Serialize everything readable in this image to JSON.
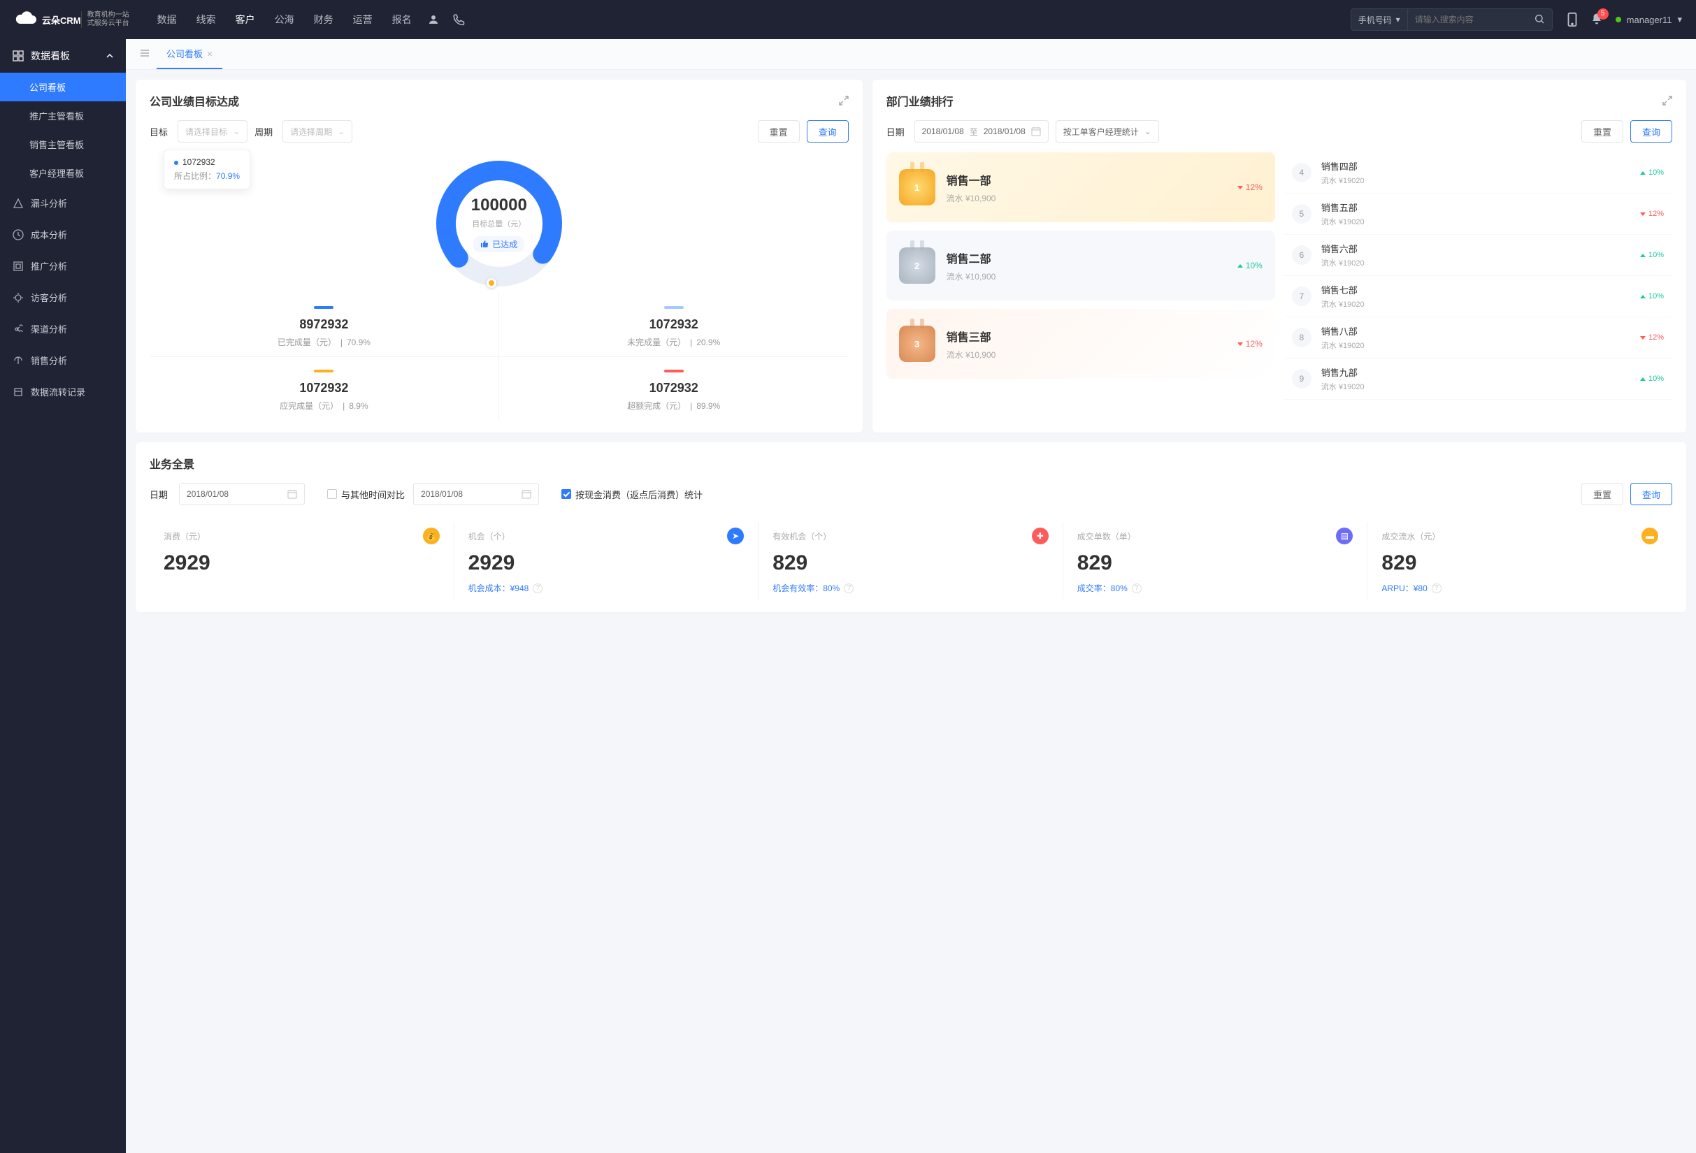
{
  "brand": {
    "main": "云朵CRM",
    "sub1": "教育机构一站",
    "sub2": "式服务云平台"
  },
  "nav": [
    "数据",
    "线索",
    "客户",
    "公海",
    "财务",
    "运营",
    "报名"
  ],
  "nav_active_idx": 2,
  "search": {
    "type_label": "手机号码",
    "placeholder": "请输入搜索内容"
  },
  "notif_count": "5",
  "username": "manager11",
  "sidebar": {
    "head": "数据看板",
    "subs": [
      "公司看板",
      "推广主管看板",
      "销售主管看板",
      "客户经理看板"
    ],
    "sub_active_idx": 0,
    "items": [
      "漏斗分析",
      "成本分析",
      "推广分析",
      "访客分析",
      "渠道分析",
      "销售分析",
      "数据流转记录"
    ]
  },
  "tab_label": "公司看板",
  "goals": {
    "title": "公司业绩目标达成",
    "target_label": "目标",
    "target_placeholder": "请选择目标",
    "period_label": "周期",
    "period_placeholder": "请选择周期",
    "reset": "重置",
    "query": "查询",
    "tooltip_value": "1072932",
    "tooltip_ratio_label": "所占比例：",
    "tooltip_ratio": "70.9%",
    "center_value": "100000",
    "center_label": "目标总量（元）",
    "achieved": "已达成",
    "stats": [
      {
        "bar": "blue",
        "value": "8972932",
        "label": "已完成量（元）",
        "pct": "70.9%"
      },
      {
        "bar": "lblue",
        "value": "1072932",
        "label": "未完成量（元）",
        "pct": "20.9%"
      },
      {
        "bar": "orange",
        "value": "1072932",
        "label": "应完成量（元）",
        "pct": "8.9%"
      },
      {
        "bar": "red",
        "value": "1072932",
        "label": "超额完成（元）",
        "pct": "89.9%"
      }
    ]
  },
  "ranking": {
    "title": "部门业绩排行",
    "date_label": "日期",
    "date_from": "2018/01/08",
    "date_to_label": "至",
    "date_to": "2018/01/08",
    "group_label": "按工单客户经理统计",
    "reset": "重置",
    "query": "查询",
    "podium": [
      {
        "rank": "1",
        "name": "销售一部",
        "sub": "流水 ¥10,900",
        "pct": "12%",
        "dir": "down",
        "cls": "gold",
        "m": "g"
      },
      {
        "rank": "2",
        "name": "销售二部",
        "sub": "流水 ¥10,900",
        "pct": "10%",
        "dir": "up",
        "cls": "silver",
        "m": "s"
      },
      {
        "rank": "3",
        "name": "销售三部",
        "sub": "流水 ¥10,900",
        "pct": "12%",
        "dir": "down",
        "cls": "bronze",
        "m": "b"
      }
    ],
    "rows": [
      {
        "num": "4",
        "name": "销售四部",
        "sub": "流水 ¥19020",
        "pct": "10%",
        "dir": "up"
      },
      {
        "num": "5",
        "name": "销售五部",
        "sub": "流水 ¥19020",
        "pct": "12%",
        "dir": "down"
      },
      {
        "num": "6",
        "name": "销售六部",
        "sub": "流水 ¥19020",
        "pct": "10%",
        "dir": "up"
      },
      {
        "num": "7",
        "name": "销售七部",
        "sub": "流水 ¥19020",
        "pct": "10%",
        "dir": "up"
      },
      {
        "num": "8",
        "name": "销售八部",
        "sub": "流水 ¥19020",
        "pct": "12%",
        "dir": "down"
      },
      {
        "num": "9",
        "name": "销售九部",
        "sub": "流水 ¥19020",
        "pct": "10%",
        "dir": "up"
      }
    ]
  },
  "overview": {
    "title": "业务全景",
    "date_label": "日期",
    "date1": "2018/01/08",
    "compare_label": "与其他时间对比",
    "date2": "2018/01/08",
    "cash_label": "按现金消费（返点后消费）统计",
    "reset": "重置",
    "query": "查询",
    "metrics": [
      {
        "label": "消费（元）",
        "value": "2929",
        "icon": "o",
        "sub": ""
      },
      {
        "label": "机会（个）",
        "value": "2929",
        "icon": "b",
        "sub_label": "机会成本：",
        "sub_val": "¥948"
      },
      {
        "label": "有效机会（个）",
        "value": "829",
        "icon": "r",
        "sub_label": "机会有效率：",
        "sub_val": "80%"
      },
      {
        "label": "成交单数（单）",
        "value": "829",
        "icon": "p",
        "sub_label": "成交率：",
        "sub_val": "80%"
      },
      {
        "label": "成交流水（元）",
        "value": "829",
        "icon": "y",
        "sub_label": "ARPU：",
        "sub_val": "¥80"
      }
    ]
  },
  "chart_data": {
    "type": "pie",
    "title": "公司业绩目标达成",
    "total_label": "目标总量（元）",
    "total": 100000,
    "series": [
      {
        "name": "已完成量（元）",
        "value": 8972932,
        "pct": 70.9,
        "color": "#2f7bff"
      },
      {
        "name": "未完成量（元）",
        "value": 1072932,
        "pct": 20.9,
        "color": "#a9c7ff"
      },
      {
        "name": "应完成量（元）",
        "value": 1072932,
        "pct": 8.9,
        "color": "#ffb020"
      },
      {
        "name": "超额完成（元）",
        "value": 1072932,
        "pct": 89.9,
        "color": "#ff5b5b"
      }
    ]
  }
}
